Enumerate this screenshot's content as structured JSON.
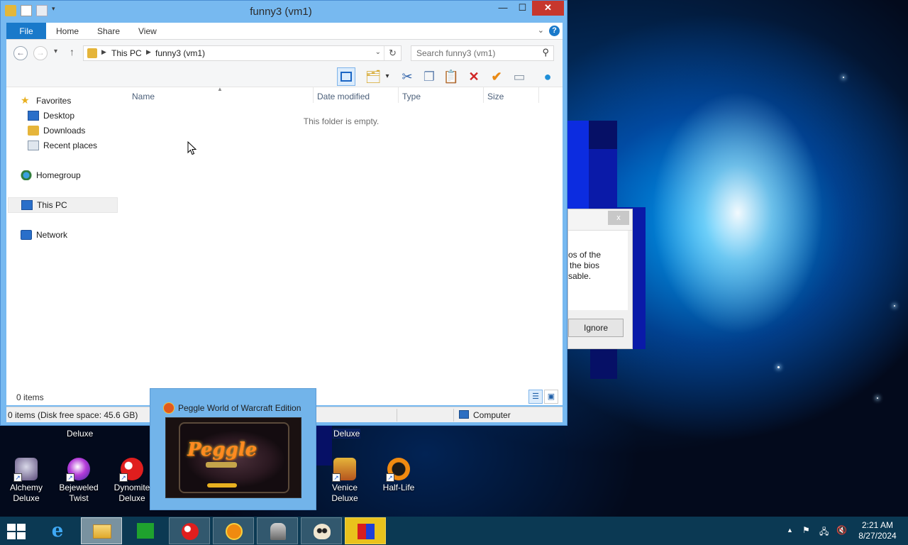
{
  "window": {
    "title": "funny3 (vm1)",
    "minimize_glyph": "—",
    "maximize_glyph": "☐",
    "close_glyph": "✕"
  },
  "ribbon": {
    "tabs": [
      "File",
      "Home",
      "Share",
      "View"
    ],
    "help_glyph": "?"
  },
  "address_bar": {
    "back_glyph": "←",
    "forward_glyph": "→",
    "recent_glyph": "▾",
    "up_glyph": "↑",
    "crumbs": [
      "This PC",
      "funny3 (vm1)"
    ],
    "separator_glyph": "▶",
    "refresh_glyph": "↻",
    "search_placeholder": "Search funny3 (vm1)",
    "search_glyph": "⚲"
  },
  "nav_pane": {
    "favorites": "Favorites",
    "desktop": "Desktop",
    "downloads": "Downloads",
    "recent_places": "Recent places",
    "homegroup": "Homegroup",
    "this_pc": "This PC",
    "network": "Network"
  },
  "file_list": {
    "columns": [
      "Name",
      "Date modified",
      "Type",
      "Size"
    ],
    "empty_message": "This folder is empty."
  },
  "status": {
    "item_count": "0 items",
    "disk_info": "0 items (Disk free space: 45.6 GB)",
    "location": "Computer"
  },
  "dialog_fragment": {
    "lines": [
      "os of the",
      "the bios",
      "sable."
    ],
    "ignore_label": "Ignore",
    "close_glyph": "x"
  },
  "desktop_icons": [
    {
      "label": "Alchemy Deluxe"
    },
    {
      "label": "Bejeweled Twist"
    },
    {
      "label": "Dynomite Deluxe"
    },
    {
      "label": "Venice Deluxe"
    },
    {
      "label": "Half-Life"
    }
  ],
  "partial_labels": {
    "deluxe_left": "Deluxe",
    "deluxe_right": "Deluxe"
  },
  "thumbnail": {
    "title": "Peggle World of Warcraft Edition",
    "logo_text": "Peggle"
  },
  "taskbar": {
    "items": [
      "start",
      "internet-explorer",
      "file-explorer",
      "store",
      "dynomite",
      "peggle",
      "robot-game",
      "skull-game",
      "block-game"
    ]
  },
  "clock": {
    "time": "2:21 AM",
    "date": "8/27/2024"
  },
  "colors": {
    "accent": "#1979ca",
    "close_red": "#c7372d",
    "window_frame": "#77b9f0",
    "taskbar": "#0b3953"
  }
}
